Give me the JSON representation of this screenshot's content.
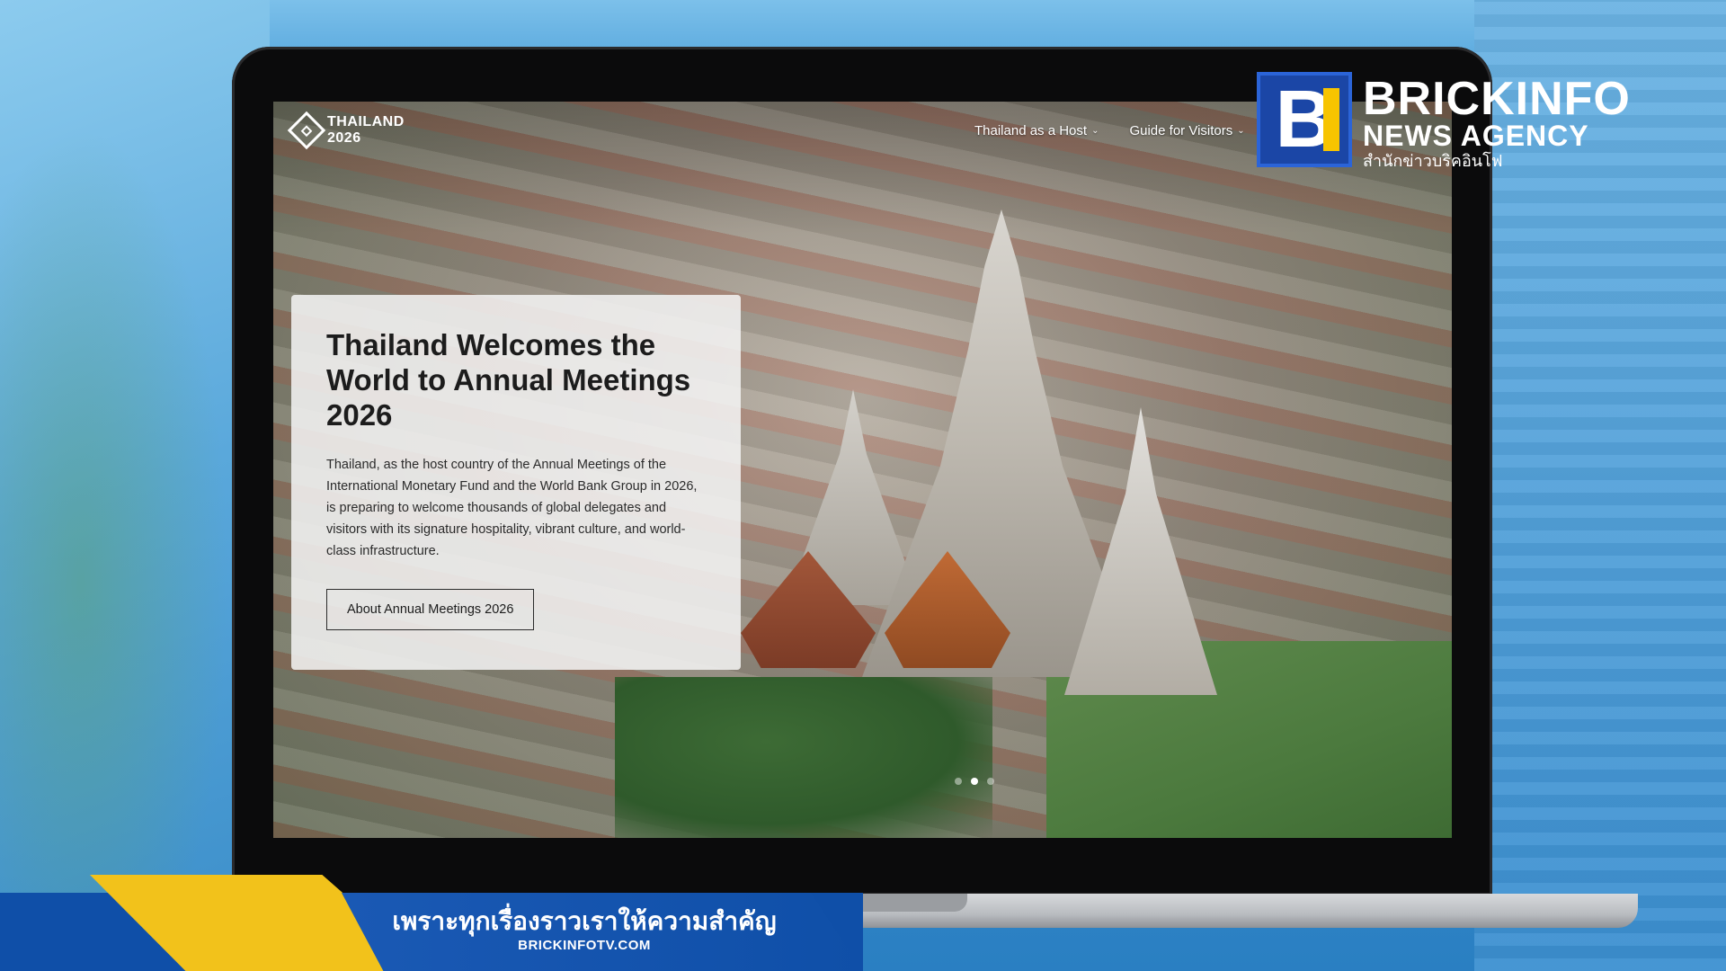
{
  "site": {
    "logo": {
      "line1": "THAILAND",
      "line2": "2026"
    },
    "nav": [
      {
        "label": "Thailand as a Host"
      },
      {
        "label": "Guide for Visitors"
      }
    ],
    "hero": {
      "title": "Thailand Welcomes the World to Annual Meetings 2026",
      "body": "Thailand, as the host country of the Annual Meetings of the International Monetary Fund and the World Bank Group in 2026, is preparing to welcome thousands of global delegates and visitors with its signature hospitality, vibrant culture, and world-class infrastructure.",
      "button_label": "About Annual Meetings 2026"
    },
    "slides": {
      "count": 3,
      "active_index": 1
    }
  },
  "watermark": {
    "name": "BRICKINFO",
    "sub": "NEWS AGENCY",
    "thai": "สำนักข่าวบริคอินโฟ"
  },
  "banner": {
    "tagline": "เพราะทุกเรื่องราวเราให้ความสำคัญ",
    "url": "BRICKINFOTV.COM"
  },
  "colors": {
    "brand_blue": "#1b46a6",
    "brand_yellow": "#f7c400",
    "banner_blue": "#0f4fa8"
  }
}
